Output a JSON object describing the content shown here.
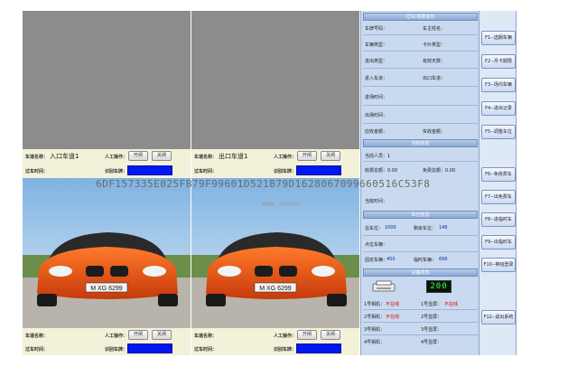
{
  "lanes": {
    "entry": {
      "name_label": "车道名称：",
      "name_value": "入口车道1",
      "manual_label": "人工操作：",
      "open_btn": "开闸",
      "close_btn": "关闸",
      "pass_time_label": "过车时间：",
      "plate_label": "识别车牌：",
      "plate_text": "M XG 6299"
    },
    "exit": {
      "name_label": "车道名称：",
      "name_value": "出口车道1",
      "manual_label": "人工操作：",
      "open_btn": "开闸",
      "close_btn": "关闸",
      "pass_time_label": "过车时间：",
      "plate_label": "识别车牌：",
      "plate_text": "M XG 6299"
    },
    "bottom_left": {
      "name_label": "车道名称：",
      "manual_label": "人工操作：",
      "open_btn": "开闸",
      "close_btn": "关闸",
      "pass_time_label": "过车时间：",
      "plate_label": "识别车牌："
    },
    "bottom_right": {
      "name_label": "车道名称：",
      "manual_label": "人工操作：",
      "open_btn": "开闸",
      "close_btn": "关闸",
      "pass_time_label": "过车时间：",
      "plate_label": "识别车牌："
    }
  },
  "watermark": "6DF157335E025FB79F99601D521B79D1628067099660516C53F8",
  "watermark_sub": "WWW.ZHUNT",
  "info_panel": {
    "section1_title": "过车/收费信息",
    "plate_no": "车牌号码：",
    "owner": "车主姓名：",
    "car_type": "车辆类型：",
    "card_type": "卡片类型：",
    "in_out_type": "进出类型：",
    "valid_days": "有效天数：",
    "in_lane": "进入车道：",
    "out_lane": "出口车道：",
    "in_time": "进场时间：",
    "out_time": "出场时间：",
    "receivable": "应收金额：",
    "received": "实收金额：",
    "section2_title": "当班信息",
    "duty_person": "当前人员：1",
    "fee_total": "收费总额：0.00",
    "free_total": "免费总额：0.00",
    "shift_time": "当班时间：",
    "section3_title": "车位信息",
    "total_spaces": "总车位：",
    "total_spaces_val": "1000",
    "remain_spaces": "剩余车位：",
    "remain_spaces_val": "146",
    "spot_spaces": "点位车辆：",
    "fixed_cars": "固定车辆：",
    "fixed_cars_val": "450",
    "temp_cars": "临时车辆：",
    "temp_cars_val": "696",
    "section4_title": "设备状态",
    "lcd_value": "200",
    "dev1": "1号相机：",
    "dev1_status": "不在线",
    "dev2": "1号显屏：",
    "dev2_status": "不在线",
    "dev3": "2号相机：",
    "dev3_status": "不在线",
    "dev4": "2号显屏：",
    "dev5": "3号相机：",
    "dev6": "3号显屏：",
    "dev7": "4号相机：",
    "dev8": "4号显屏："
  },
  "function_keys": [
    "F1--选期车辆",
    "F2--月卡期限",
    "F3--场内车辆",
    "F4--进出记录",
    "F5--调整车位",
    "F6--免收费车",
    "F7--出免费车",
    "F8--进临时车",
    "F9--出临时车",
    "F10--换班登录",
    "F12--退出系统"
  ],
  "colors": {
    "camera_bg": "#8c8c8c",
    "panel_bg": "#c9daf0",
    "header_blue": "#8aa8d4",
    "plate_field": "#0018f0",
    "lcd_green": "#3dff4a",
    "offline_red": "#e00000"
  }
}
